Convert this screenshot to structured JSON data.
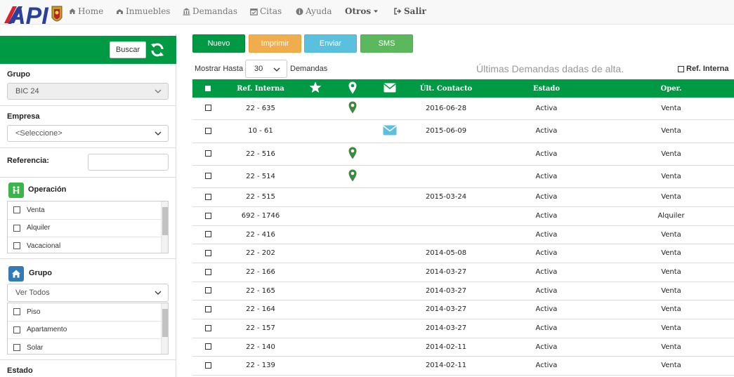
{
  "nav": {
    "logo_text": "API",
    "items": [
      {
        "label": "Home",
        "icon": "home-icon"
      },
      {
        "label": "Inmuebles",
        "icon": "building-icon"
      },
      {
        "label": "Demandas",
        "icon": "bank-icon"
      },
      {
        "label": "Citas",
        "icon": "calendar-icon"
      },
      {
        "label": "Ayuda",
        "icon": "info-icon"
      },
      {
        "label": "Otros",
        "icon": "caret-down-icon"
      },
      {
        "label": "Salir",
        "icon": "sign-out-icon"
      }
    ]
  },
  "sidebar": {
    "buscar_label": "Buscar",
    "grupo_label": "Grupo",
    "grupo_value": "BIC 24",
    "empresa_label": "Empresa",
    "empresa_value": "<Seleccione>",
    "referencia_label": "Referencia:",
    "referencia_value": "",
    "operacion_label": "Operación",
    "operacion_items": [
      "Venta",
      "Alquiler",
      "Vacacional"
    ],
    "grupo2_label": "Grupo",
    "grupo2_value": "Ver Todos",
    "grupo2_items": [
      "Piso",
      "Apartamento",
      "Solar"
    ],
    "estado_label": "Estado"
  },
  "toolbar": {
    "nuevo": "Nuevo",
    "imprimir": "Imprimir",
    "enviar": "Enviar",
    "sms": "SMS"
  },
  "controls": {
    "mostrar_label": "Mostrar Hasta",
    "mostrar_value": "30",
    "demandas_label": "Demandas",
    "info_text": "Últimas Demandas dadas de alta.",
    "ref_interna_label": "Ref. Interna"
  },
  "table": {
    "headers": {
      "ref": "Ref. Interna",
      "contacto": "Últ. Contacto",
      "estado": "Estado",
      "oper": "Oper."
    },
    "rows": [
      {
        "ref": "22 - 635",
        "pin": true,
        "mail": false,
        "contacto": "2016-06-28",
        "estado": "Activa",
        "oper": "Venta"
      },
      {
        "ref": "10 - 61",
        "pin": false,
        "mail": true,
        "contacto": "2015-06-09",
        "estado": "Activa",
        "oper": "Venta"
      },
      {
        "ref": "22 - 516",
        "pin": true,
        "mail": false,
        "contacto": "",
        "estado": "Activa",
        "oper": "Venta"
      },
      {
        "ref": "22 - 514",
        "pin": true,
        "mail": false,
        "contacto": "",
        "estado": "Activa",
        "oper": "Venta"
      },
      {
        "ref": "22 - 515",
        "pin": false,
        "mail": false,
        "contacto": "2015-03-24",
        "estado": "Activa",
        "oper": "Venta"
      },
      {
        "ref": "692 - 1746",
        "pin": false,
        "mail": false,
        "contacto": "",
        "estado": "Activa",
        "oper": "Alquiler"
      },
      {
        "ref": "22 - 416",
        "pin": false,
        "mail": false,
        "contacto": "",
        "estado": "Activa",
        "oper": "Venta"
      },
      {
        "ref": "22 - 202",
        "pin": false,
        "mail": false,
        "contacto": "2014-05-08",
        "estado": "Activa",
        "oper": "Venta"
      },
      {
        "ref": "22 - 166",
        "pin": false,
        "mail": false,
        "contacto": "2014-03-27",
        "estado": "Activa",
        "oper": "Venta"
      },
      {
        "ref": "22 - 165",
        "pin": false,
        "mail": false,
        "contacto": "2014-03-27",
        "estado": "Activa",
        "oper": "Venta"
      },
      {
        "ref": "22 - 164",
        "pin": false,
        "mail": false,
        "contacto": "2014-03-27",
        "estado": "Activa",
        "oper": "Venta"
      },
      {
        "ref": "22 - 157",
        "pin": false,
        "mail": false,
        "contacto": "2014-03-27",
        "estado": "Activa",
        "oper": "Venta"
      },
      {
        "ref": "22 - 140",
        "pin": false,
        "mail": false,
        "contacto": "2014-02-11",
        "estado": "Activa",
        "oper": "Venta"
      },
      {
        "ref": "22 - 139",
        "pin": false,
        "mail": false,
        "contacto": "2014-02-11",
        "estado": "Activa",
        "oper": "Venta"
      }
    ]
  },
  "colors": {
    "brand_green": "#009a44",
    "nuevo": "#009a44",
    "imprimir": "#f0ad4e",
    "enviar": "#5bc0de",
    "sms": "#5cb85c",
    "logo_blue": "#2b3f9b",
    "logo_red": "#d9232d"
  }
}
